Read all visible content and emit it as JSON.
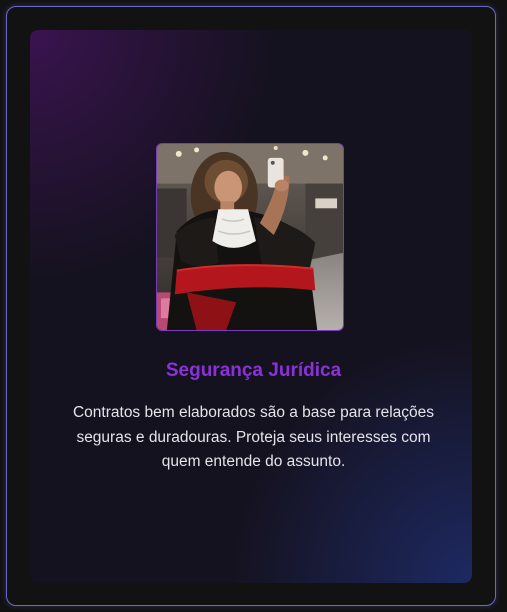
{
  "card": {
    "title": "Segurança Jurídica",
    "description": "Contratos bem elaborados são a base para relações seguras e duradouras. Proteja seus interesses com quem entende do assunto.",
    "photo_alt": "Advogada com beca preta e vermelha tirando selfie no espelho",
    "colors": {
      "title": "#8a32d8",
      "text": "#e4e4ea",
      "frame_border": "#6b67c9",
      "photo_border": "#7a3db8",
      "background": "#121212"
    }
  }
}
